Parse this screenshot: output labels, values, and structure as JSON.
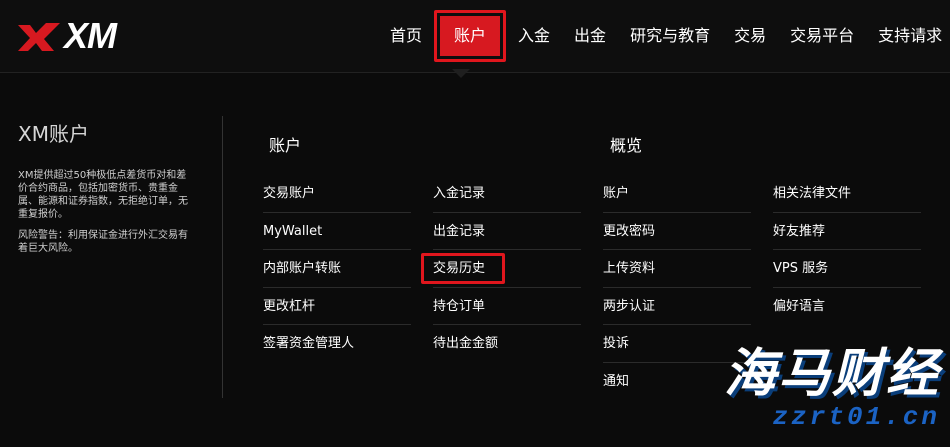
{
  "header": {
    "logo_text": "XM",
    "nav": [
      {
        "label": "首页",
        "active": false
      },
      {
        "label": "账户",
        "active": true
      },
      {
        "label": "入金",
        "active": false
      },
      {
        "label": "出金",
        "active": false
      },
      {
        "label": "研究与教育",
        "active": false
      },
      {
        "label": "交易",
        "active": false
      },
      {
        "label": "交易平台",
        "active": false
      },
      {
        "label": "支持请求",
        "active": false
      }
    ]
  },
  "intro": {
    "title": "XM账户",
    "description": "XM提供超过50种极低点差货币对和差价合约商品，包括加密货币、贵重金属、能源和证券指数，无拒绝订单，无重复报价。",
    "warning": "风险警告：利用保证金进行外汇交易有着巨大风险。"
  },
  "sections": {
    "account": {
      "heading": "账户",
      "col1": [
        "交易账户",
        "MyWallet",
        "内部账户转账",
        "更改杠杆",
        "签署资金管理人"
      ],
      "col2": [
        "入金记录",
        "出金记录",
        "交易历史",
        "持仓订单",
        "待出金金额"
      ]
    },
    "overview": {
      "heading": "概览",
      "col1": [
        "账户",
        "更改密码",
        "上传资料",
        "两步认证",
        "投诉",
        "通知"
      ],
      "col2": [
        "相关法律文件",
        "好友推荐",
        "VPS 服务",
        "偏好语言"
      ]
    }
  },
  "watermark": {
    "name": "海马财经",
    "url": "zzrt01.cn"
  },
  "colors": {
    "accent": "#d71920",
    "background": "#0b0b0b",
    "divider": "#2b2b2b"
  }
}
